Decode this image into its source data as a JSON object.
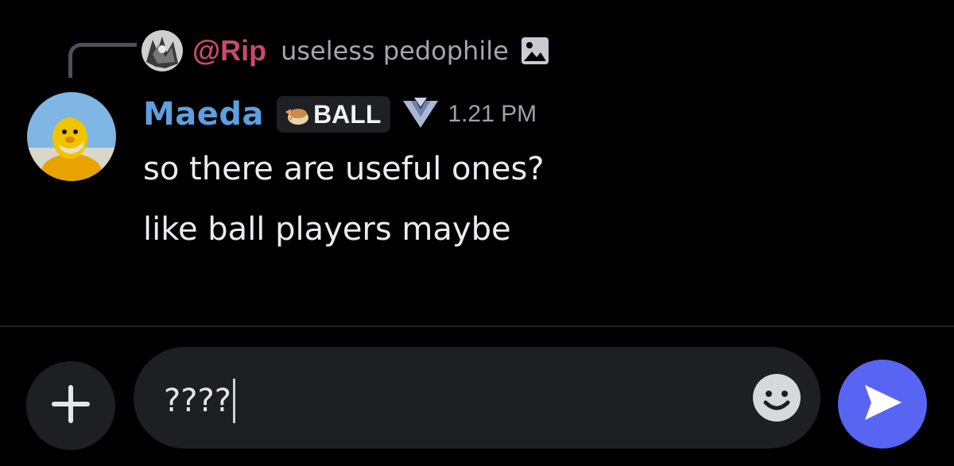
{
  "colors": {
    "reply_name": "#c84a6b",
    "username": "#5e9fe0",
    "send_button": "#5865f2"
  },
  "reply": {
    "name": "@Rip",
    "text": "useless pedophile",
    "attachment_icon": "image-icon"
  },
  "message": {
    "username": "Maeda",
    "tag": {
      "icon": "fist-icon",
      "label": "BALL"
    },
    "rank_icon": "rank-chevron-icon",
    "timestamp": "1.21 PM",
    "lines": [
      "so there are useful ones?",
      "like ball players maybe"
    ]
  },
  "composer": {
    "attach_icon": "plus-icon",
    "input_value": "????",
    "emoji_icon": "smiley-icon",
    "send_icon": "send-arrow-icon"
  }
}
